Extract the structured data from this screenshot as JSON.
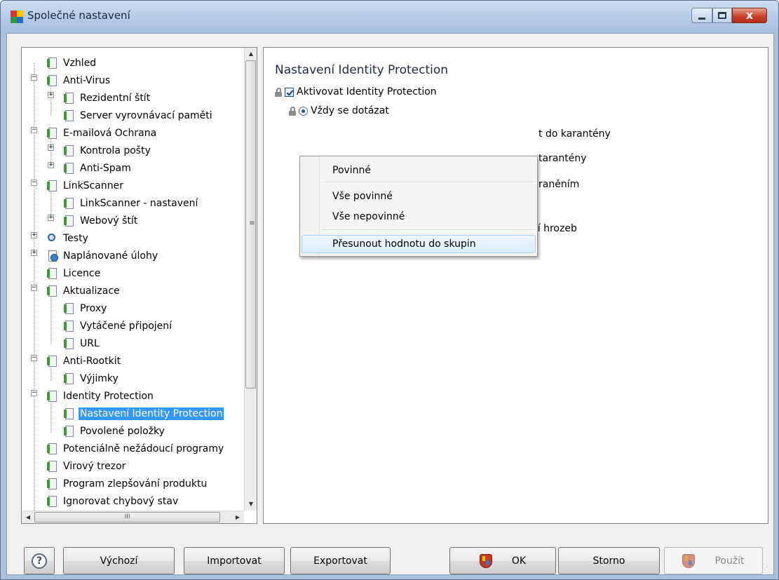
{
  "window": {
    "title": "Společné nastavení",
    "close_label": "x"
  },
  "tree": {
    "items": [
      {
        "label": "Vzhled"
      },
      {
        "label": "Anti-Virus"
      },
      {
        "label": "Rezidentní štít"
      },
      {
        "label": "Server vyrovnávací paměti"
      },
      {
        "label": "E-mailová Ochrana"
      },
      {
        "label": "Kontrola pošty"
      },
      {
        "label": "Anti-Spam"
      },
      {
        "label": "LinkScanner"
      },
      {
        "label": "LinkScanner - nastavení"
      },
      {
        "label": "Webový štít"
      },
      {
        "label": "Testy"
      },
      {
        "label": "Naplánované úlohy"
      },
      {
        "label": "Licence"
      },
      {
        "label": "Aktualizace"
      },
      {
        "label": "Proxy"
      },
      {
        "label": "Vytáčené připojení"
      },
      {
        "label": "URL"
      },
      {
        "label": "Anti-Rootkit"
      },
      {
        "label": "Výjimky"
      },
      {
        "label": "Identity Protection"
      },
      {
        "label": "Nastavení Identity Protection"
      },
      {
        "label": "Povolené položky"
      },
      {
        "label": "Potenciálně nežádoucí programy"
      },
      {
        "label": "Virový trezor"
      },
      {
        "label": "Program zlepšování produktu"
      },
      {
        "label": "Ignorovat chybový stav"
      }
    ],
    "selected": "Nastavení Identity Protection",
    "hscroll_grip": "III",
    "vscroll_grip": "≡"
  },
  "settings": {
    "title": "Nastavení Identity Protection",
    "activate_label": "Aktivovat Identity Protection",
    "radio_always_ask": "Vždy se dotázat",
    "partial_1": "t do karantény",
    "partial_2": "tarantény",
    "partial_3": "raněním",
    "show_final_info": "Zobrazit závěrečné informace o odstranění hrozeb"
  },
  "context_menu": {
    "items": [
      {
        "label": "Povinné"
      },
      {
        "label": "Vše povinné"
      },
      {
        "label": "Vše nepovinné"
      },
      {
        "label": "Přesunout hodnotu do skupin"
      }
    ],
    "hovered": "Přesunout hodnotu do skupin"
  },
  "buttons": {
    "help": "?",
    "default": "Výchozí",
    "import": "Importovat",
    "export": "Exportovat",
    "ok": "OK",
    "cancel": "Storno",
    "apply": "Použít"
  },
  "colors": {
    "selection": "#3399ff",
    "title_bar": "#b7cde8",
    "close_button": "#c8432c"
  }
}
